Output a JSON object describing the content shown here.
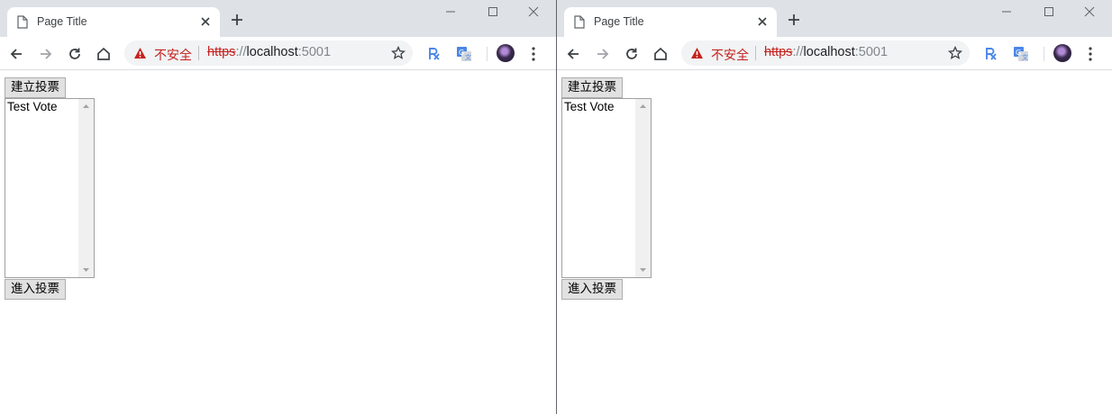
{
  "windows": [
    {
      "tab": {
        "title": "Page Title"
      },
      "omnibox": {
        "security_label": "不安全",
        "url_scheme": "https",
        "url_separator": "://",
        "url_host": "localhost",
        "url_port": ":5001"
      },
      "page": {
        "create_button": "建立投票",
        "list_items": [
          "Test Vote"
        ],
        "enter_button": "進入投票"
      }
    },
    {
      "tab": {
        "title": "Page Title"
      },
      "omnibox": {
        "security_label": "不安全",
        "url_scheme": "https",
        "url_separator": "://",
        "url_host": "localhost",
        "url_port": ":5001"
      },
      "page": {
        "create_button": "建立投票",
        "list_items": [
          "Test Vote"
        ],
        "enter_button": "進入投票"
      }
    }
  ],
  "colors": {
    "tabstrip_bg": "#dee1e6",
    "insecure_red": "#c5221f",
    "omnibox_bg": "#f1f3f4"
  },
  "icons": [
    "page-icon",
    "close-icon",
    "plus-icon",
    "minimize-icon",
    "maximize-icon",
    "back-arrow-icon",
    "forward-arrow-icon",
    "reload-icon",
    "home-icon",
    "warning-icon",
    "star-icon",
    "extension-rx-icon",
    "translate-icon",
    "avatar",
    "kebab-menu-icon"
  ]
}
